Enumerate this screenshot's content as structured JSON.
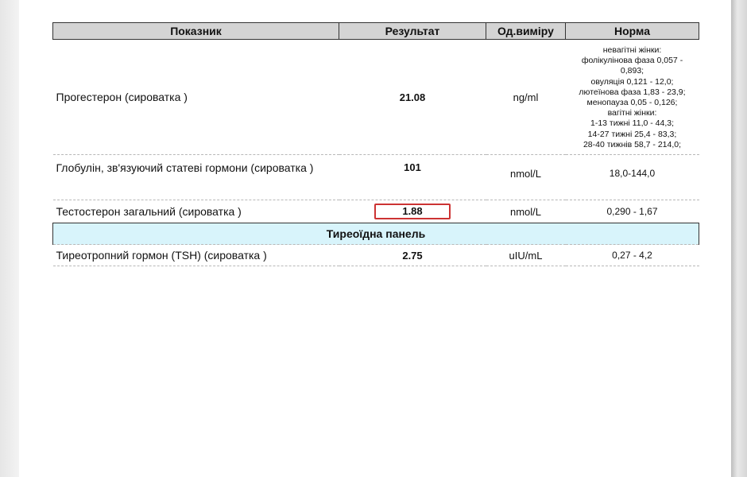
{
  "table": {
    "headers": {
      "indicator": "Показник",
      "result": "Результат",
      "unit": "Од.виміру",
      "norm": "Норма"
    },
    "rows": [
      {
        "name": "Прогестерон (сироватка )",
        "result": "21.08",
        "unit": "ng/ml",
        "norm_lines": [
          "невагітні жінки:",
          "фолікулінова фаза  0,057 -",
          "0,893;",
          "овуляція 0,121 - 12,0;",
          "лютеїнова фаза 1,83 - 23,9;",
          "менопауза  0,05 - 0,126;",
          "вагітні жінки:",
          "1-13 тижні 11,0 - 44,3;",
          "14-27 тижні 25,4 - 83,3;",
          "28-40 тижнів 58,7 - 214,0;"
        ]
      },
      {
        "name": "Глобулін, зв'язуючий статеві гормони (сироватка )",
        "result": "101",
        "unit": "nmol/L",
        "norm": "18,0-144,0"
      },
      {
        "name": "Тестостерон загальний (сироватка )",
        "result": "1.88",
        "unit": "nmol/L",
        "norm": "0,290 - 1,67",
        "flag_color": "#cc3333"
      }
    ],
    "section": "Тиреоїдна панель",
    "thyroid_rows": [
      {
        "name": "Тиреотропний гормон (TSH) (сироватка )",
        "result": "2.75",
        "unit": "uIU/mL",
        "norm": "0,27 - 4,2"
      }
    ]
  },
  "colors": {
    "header_bg": "#d4d4d4",
    "section_bg": "#d8f4fb",
    "flag_border": "#cc3333"
  }
}
